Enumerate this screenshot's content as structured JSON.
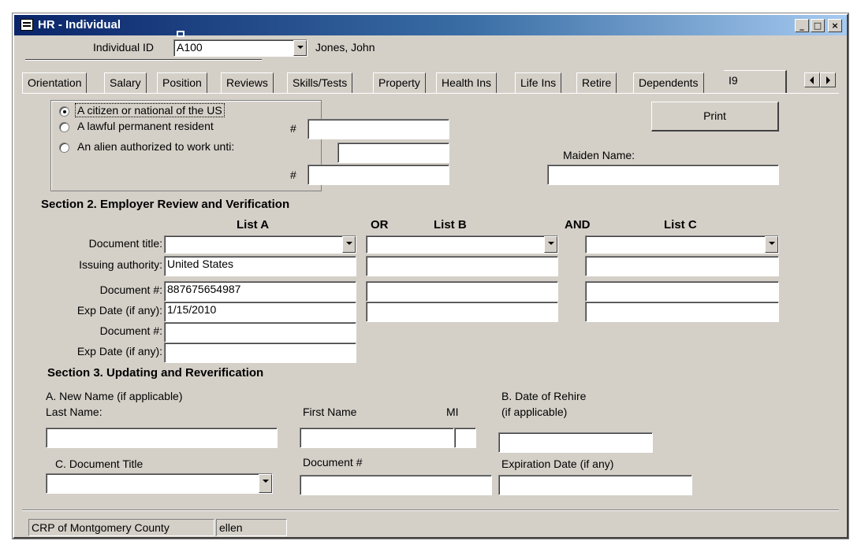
{
  "window": {
    "title": "HR - Individual"
  },
  "header": {
    "individual_id_label": "Individual ID",
    "individual_id_value": "A100",
    "individual_name": "Jones, John"
  },
  "tabs": [
    {
      "label": "Orientation"
    },
    {
      "label": "Salary"
    },
    {
      "label": "Position"
    },
    {
      "label": "Reviews"
    },
    {
      "label": "Skills/Tests"
    },
    {
      "label": "Property"
    },
    {
      "label": "Health Ins"
    },
    {
      "label": "Life Ins"
    },
    {
      "label": "Retire"
    },
    {
      "label": "Dependents"
    },
    {
      "label": "I9"
    }
  ],
  "section1": {
    "options": [
      {
        "label": "A citizen or national of the US",
        "checked": true
      },
      {
        "label": "A lawful permanent resident",
        "checked": false
      },
      {
        "label": "An alien authorized to work unti:",
        "checked": false
      }
    ],
    "hash_label": "#",
    "print_button": "Print",
    "maiden_name_label": "Maiden Name:"
  },
  "section2": {
    "title": "Section 2. Employer Review and Verification",
    "list_a": "List A",
    "or": "OR",
    "list_b": "List B",
    "and": "AND",
    "list_c": "List C",
    "row_labels": [
      "Document title:",
      "Issuing authority:",
      "Document #:",
      "Exp Date (if any):",
      "Document #:",
      "Exp Date (if any):"
    ],
    "list_a_values": {
      "issuing_authority": "United States",
      "document_number": "887675654987",
      "exp_date": "1/15/2010"
    }
  },
  "section3": {
    "title": "Section 3. Updating and Reverification",
    "new_name_label": "A. New Name (if applicable)",
    "last_name_label": "Last Name:",
    "first_name_label": "First Name",
    "mi_label": "MI",
    "rehire_label_1": "B. Date of Rehire",
    "rehire_label_2": "(if applicable)",
    "doc_title_label": "C. Document Title",
    "doc_number_label": "Document #",
    "exp_date_label": "Expiration Date (if any)"
  },
  "statusbar": {
    "org": "CRP of Montgomery County",
    "user": "ellen"
  }
}
